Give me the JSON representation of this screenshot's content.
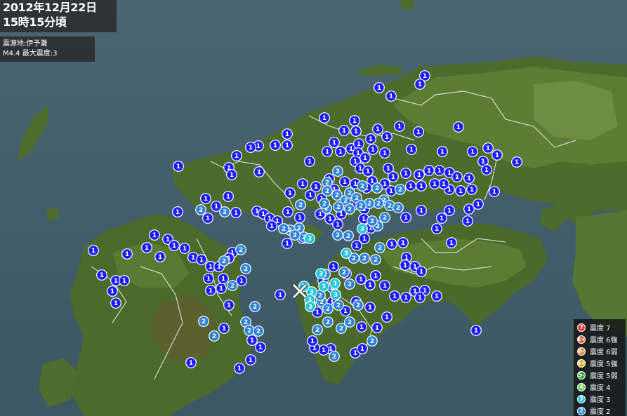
{
  "header": {
    "date": "2012年12月22日",
    "time": "15時15分頃"
  },
  "quake": {
    "epicenter": "震源地:伊予灘",
    "magnitude_line": "M4.4 最大震度:3"
  },
  "legend": [
    {
      "badge": "7",
      "label": "震度 7",
      "color": "#e23b2e"
    },
    {
      "badge": "6+",
      "label": "震度 6強",
      "color": "#e0612e"
    },
    {
      "badge": "6-",
      "label": "震度 6弱",
      "color": "#e58a2b"
    },
    {
      "badge": "5+",
      "label": "震度 5強",
      "color": "#d8b320"
    },
    {
      "badge": "5-",
      "label": "震度 5弱",
      "color": "#33a638"
    },
    {
      "badge": "4",
      "label": "震度 4",
      "color": "#6ccd4e"
    },
    {
      "badge": "3",
      "label": "震度 3",
      "color": "#21c6dc"
    },
    {
      "badge": "2",
      "label": "震度 2",
      "color": "#2e83d8"
    }
  ],
  "colors": {
    "intensity1": "#1e1eff",
    "intensity2": "#2e83d8",
    "intensity3": "#21c6dc"
  },
  "epicenter_icon": "cross-icon"
}
